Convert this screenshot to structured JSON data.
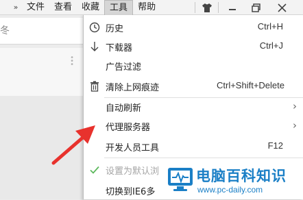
{
  "menubar": {
    "nav_arrow": "»",
    "items": [
      {
        "label": "文件"
      },
      {
        "label": "查看"
      },
      {
        "label": "收藏"
      },
      {
        "label": "工具"
      },
      {
        "label": "帮助"
      }
    ],
    "active_index": 3
  },
  "left_pane": {
    "search_glyph": "冬"
  },
  "dropdown": {
    "items": [
      {
        "label": "历史",
        "shortcut": "Ctrl+H",
        "icon": "clock-icon"
      },
      {
        "label": "下载器",
        "shortcut": "Ctrl+J",
        "icon": "download-arrow-icon"
      },
      {
        "label": "广告过滤",
        "shortcut": "",
        "icon": ""
      },
      {
        "label": "清除上网痕迹",
        "shortcut": "Ctrl+Shift+Delete",
        "icon": "trash-icon"
      },
      {
        "label": "自动刷新",
        "shortcut": "",
        "icon": "",
        "submenu": true
      },
      {
        "label": "代理服务器",
        "shortcut": "",
        "icon": "",
        "submenu": true
      },
      {
        "label": "开发人员工具",
        "shortcut": "F12",
        "icon": ""
      },
      {
        "label": "设置为默认浏",
        "shortcut": "",
        "icon": "checkmark-icon",
        "disabled": true
      },
      {
        "label": "切换到IE6多",
        "shortcut": "",
        "icon": ""
      }
    ],
    "submenu_chevron": "›"
  },
  "watermark": {
    "title": "电脑百科知识",
    "url": "www.pc-daily.com"
  },
  "colors": {
    "annotation_arrow": "#e8322d",
    "watermark_blue": "#1a7fc6",
    "check_green": "#5cb85c"
  }
}
